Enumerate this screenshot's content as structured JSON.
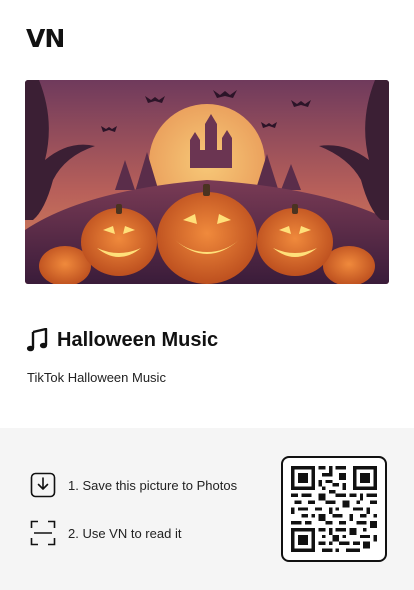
{
  "logo": {
    "text": "VN"
  },
  "hero": {
    "image_icon": "halloween-pumpkins-image"
  },
  "music": {
    "icon": "music-note-icon",
    "title": "Halloween Music",
    "subtitle": "TikTok Halloween Music"
  },
  "steps": [
    {
      "icon": "download-icon",
      "label": "1. Save this picture to Photos"
    },
    {
      "icon": "scan-icon",
      "label": "2. Use VN to read it"
    }
  ],
  "qr": {
    "icon": "qr-code-icon"
  },
  "colors": {
    "background": "#ffffff",
    "panel": "#f5f5f5",
    "text": "#111111"
  }
}
